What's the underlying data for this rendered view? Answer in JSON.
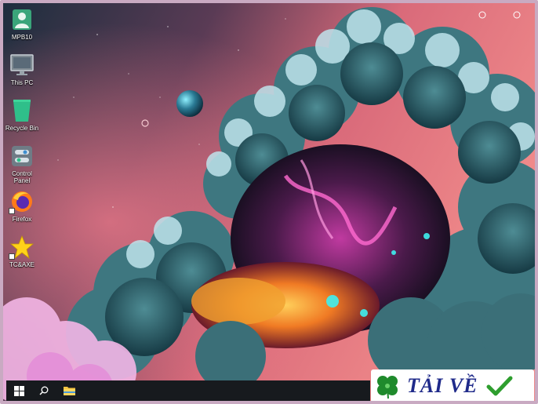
{
  "desktop": {
    "icons": [
      {
        "label": "MPB10",
        "icon": "user-folder-icon"
      },
      {
        "label": "This PC",
        "icon": "monitor-icon"
      },
      {
        "label": "Recycle Bin",
        "icon": "recycle-bin-icon"
      },
      {
        "label": "Control Panel",
        "icon": "control-panel-icon"
      },
      {
        "label": "Firefox",
        "icon": "firefox-icon"
      },
      {
        "label": "TC&AXE",
        "icon": "star-icon"
      }
    ]
  },
  "taskbar": {
    "items": [
      "start-icon",
      "search-icon",
      "file-explorer-icon"
    ]
  },
  "watermark": {
    "text": "TẢI VỀ",
    "icon_left": "clover-icon",
    "icon_right": "checkmark-icon"
  },
  "colors": {
    "taskbar": "#171a1e",
    "watermark_text": "#1f2a8a",
    "check_green": "#2e9e2e",
    "clover_green": "#1f8a2c"
  }
}
